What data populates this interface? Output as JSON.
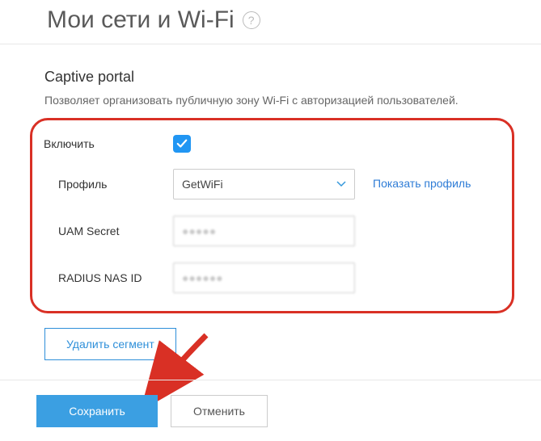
{
  "header": {
    "title": "Мои сети и Wi-Fi"
  },
  "section": {
    "title": "Captive portal",
    "description": "Позволяет организовать публичную зону Wi-Fi с авторизацией пользователей."
  },
  "form": {
    "enable_label": "Включить",
    "enable_checked": true,
    "profile_label": "Профиль",
    "profile_value": "GetWiFi",
    "show_profile_link": "Показать профиль",
    "uam_secret_label": "UAM Secret",
    "uam_secret_value": "●●●●●",
    "radius_label": "RADIUS NAS ID",
    "radius_value": "●●●●●●"
  },
  "actions": {
    "delete_segment": "Удалить сегмент",
    "save": "Сохранить",
    "cancel": "Отменить"
  }
}
